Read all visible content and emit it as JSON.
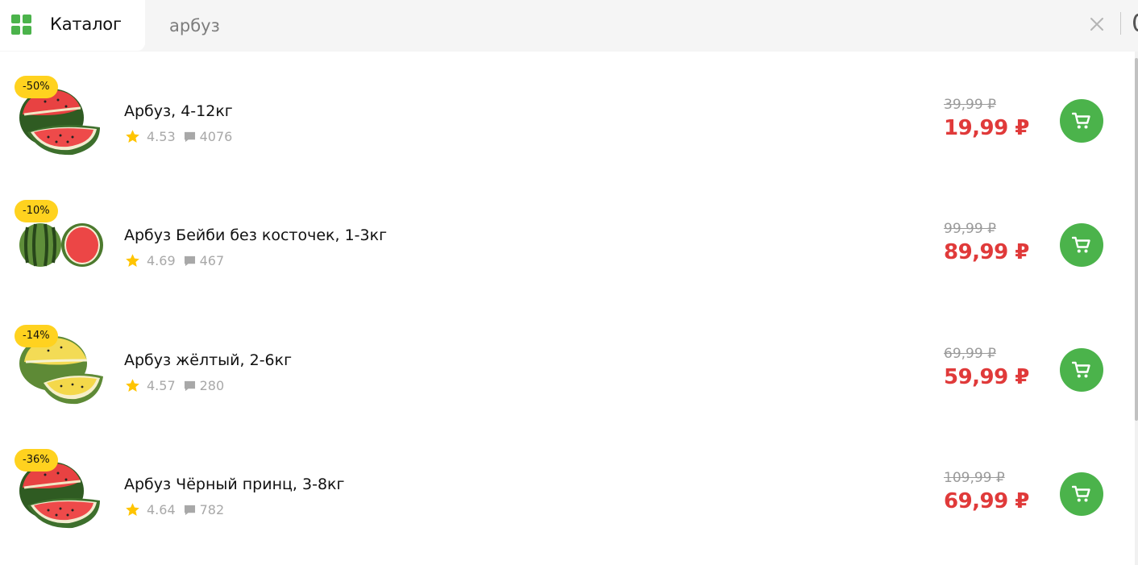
{
  "header": {
    "catalog_label": "Каталог",
    "search": {
      "value": "арбуз",
      "placeholder": ""
    }
  },
  "colors": {
    "accent": "#4bb34b",
    "sale_price": "#e03a3a",
    "badge": "#ffd21f",
    "muted": "#a8a8a8"
  },
  "icons": [
    "catalog-grid-icon",
    "clear-icon",
    "star-icon",
    "comment-icon",
    "cart-icon"
  ],
  "products": [
    {
      "name": "Арбуз, 4-12кг",
      "discount": "-50%",
      "rating": "4.53",
      "reviews": "4076",
      "old_price": "39,99 ₽",
      "price": "19,99 ₽",
      "variant": "red"
    },
    {
      "name": "Арбуз Бейби без косточек, 1-3кг",
      "discount": "-10%",
      "rating": "4.69",
      "reviews": "467",
      "old_price": "99,99 ₽",
      "price": "89,99 ₽",
      "variant": "baby"
    },
    {
      "name": "Арбуз жёлтый, 2-6кг",
      "discount": "-14%",
      "rating": "4.57",
      "reviews": "280",
      "old_price": "69,99 ₽",
      "price": "59,99 ₽",
      "variant": "yellow"
    },
    {
      "name": "Арбуз Чёрный принц, 3-8кг",
      "discount": "-36%",
      "rating": "4.64",
      "reviews": "782",
      "old_price": "109,99 ₽",
      "price": "69,99 ₽",
      "variant": "red"
    }
  ]
}
